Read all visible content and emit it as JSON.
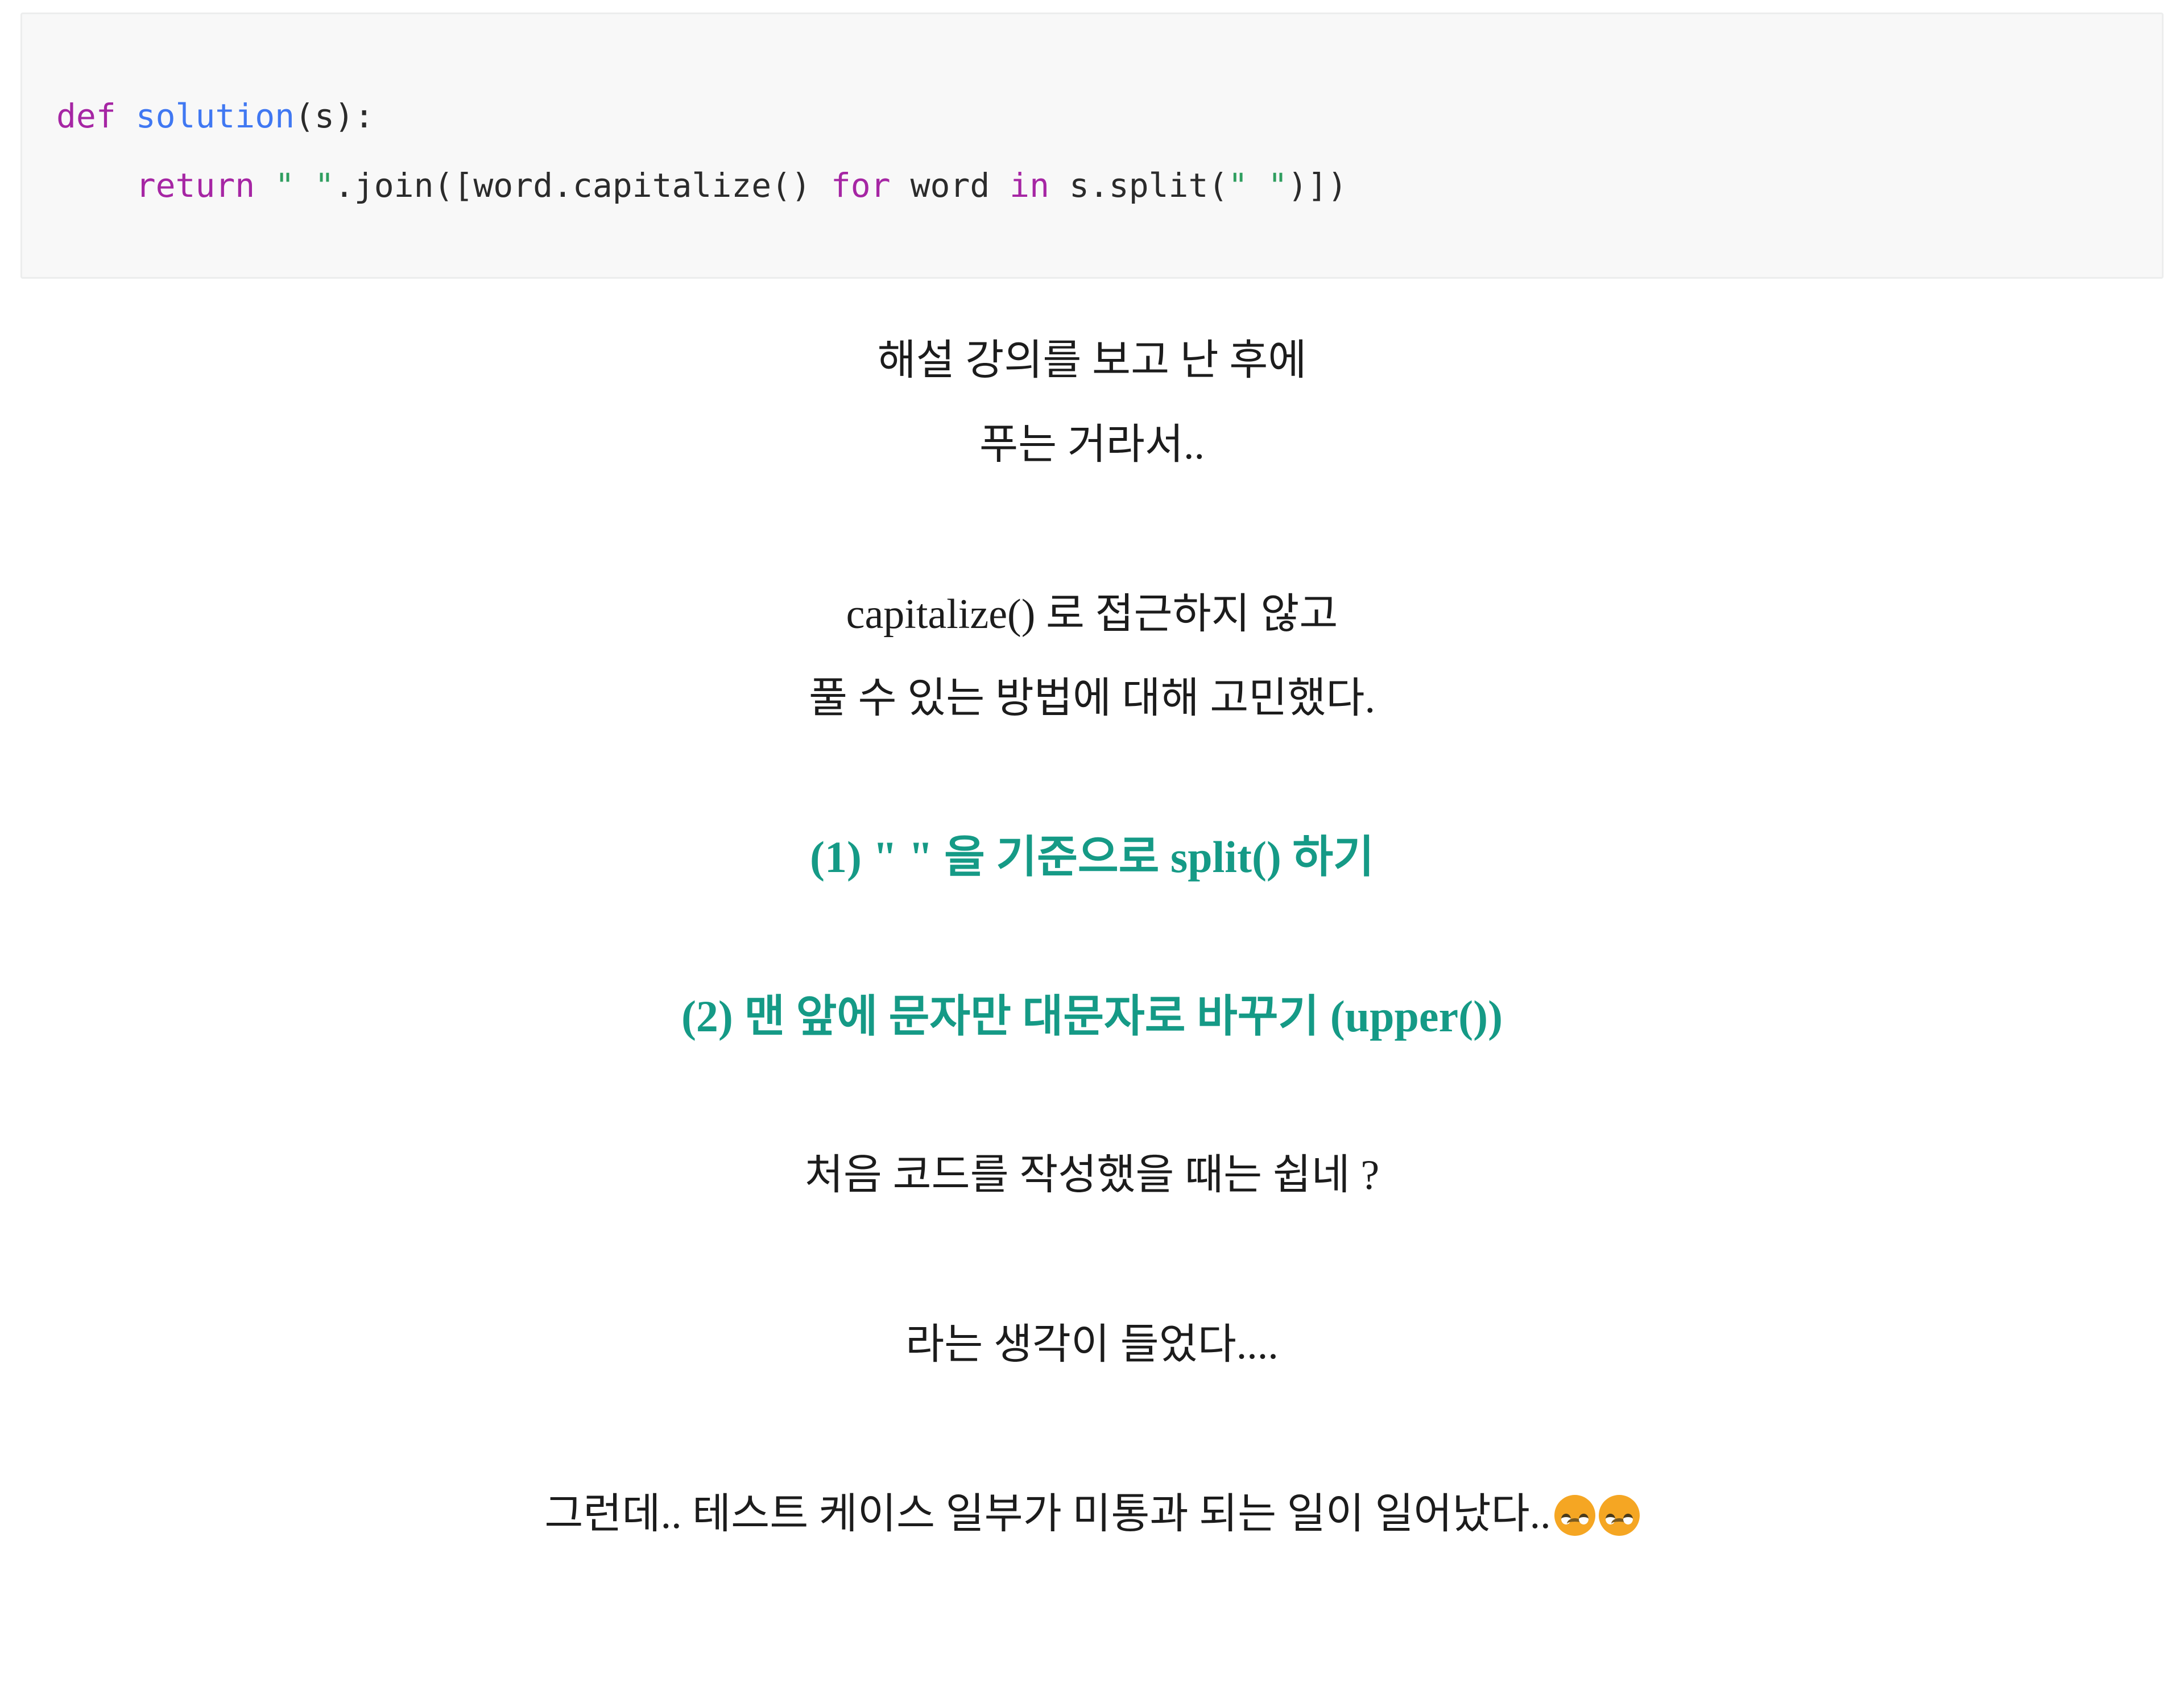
{
  "code_block": {
    "language": "python",
    "background_color": "#f8f8f8",
    "border_color": "#eceded",
    "lines": [
      {
        "tokens": [
          {
            "text": "def ",
            "type": "keyword"
          },
          {
            "text": "solution",
            "type": "function"
          },
          {
            "text": "(s):",
            "type": "plain"
          }
        ]
      },
      {
        "tokens": [
          {
            "text": "    ",
            "type": "plain"
          },
          {
            "text": "return ",
            "type": "keyword"
          },
          {
            "text": "\" \"",
            "type": "string"
          },
          {
            "text": ".join([word.capitalize() ",
            "type": "plain"
          },
          {
            "text": "for ",
            "type": "keyword"
          },
          {
            "text": "word ",
            "type": "plain"
          },
          {
            "text": "in ",
            "type": "keyword"
          },
          {
            "text": "s.split(",
            "type": "plain"
          },
          {
            "text": "\" \"",
            "type": "string"
          },
          {
            "text": ")])",
            "type": "plain"
          }
        ]
      }
    ],
    "plain_text": "def solution(s):\n    return \" \".join([word.capitalize() for word in s.split(\" \")])",
    "token_colors": {
      "keyword": "#a626a4",
      "function": "#4078f2",
      "string": "#2f9e5f",
      "plain": "#2b2b2b"
    }
  },
  "body": {
    "text_color": "#1c1c1c",
    "accent_color": "#159a86",
    "paragraph_1": {
      "line_1": "해설 강의를 보고 난 후에",
      "line_2": "푸는 거라서.."
    },
    "paragraph_2": {
      "line_1": "capitalize() 로 접근하지 않고",
      "line_2": "풀 수 있는 방법에 대해 고민했다."
    },
    "step_1": "(1) \" \" 을 기준으로 split() 하기",
    "step_2": "(2) 맨 앞에 문자만 대문자로 바꾸기 (upper())",
    "paragraph_3": "처음 코드를 작성했을 때는 쉽네 ?",
    "paragraph_4": "라는 생각이 들었다....",
    "paragraph_5": {
      "text": "그런데.. 테스트 케이스 일부가 미통과 되는 일이 일어났다..",
      "emoji_1": "😞",
      "emoji_2": "😞",
      "emoji_name": "disappointed-face"
    }
  }
}
